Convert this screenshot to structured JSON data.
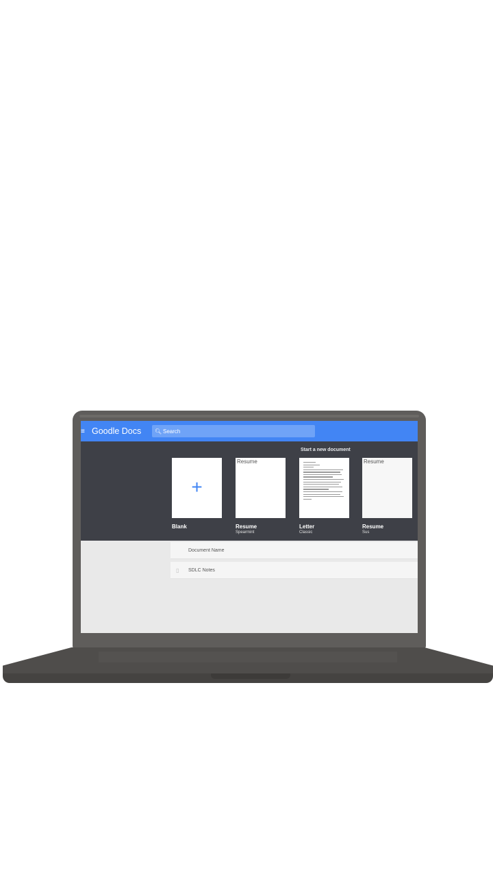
{
  "app": {
    "title": "Goodle Docs",
    "menu_icon": "≡",
    "search": {
      "icon": "search-icon",
      "placeholder": "Search"
    }
  },
  "templates": {
    "heading": "Start a new document",
    "items": [
      {
        "name": "Blank",
        "subtitle": "",
        "thumbnail": "plus",
        "plus": "+"
      },
      {
        "name": "Resume",
        "subtitle": "Spearmint",
        "thumbnail_alt": "Resume"
      },
      {
        "name": "Letter",
        "subtitle": "Classic",
        "thumbnail": "letter-preview"
      },
      {
        "name": "Resume",
        "subtitle": "Sus",
        "thumbnail_alt": "Resume"
      }
    ]
  },
  "documents": [
    {
      "name": "Document Name",
      "icon": "doc-icon"
    },
    {
      "name": "SDLC Notes",
      "icon": "doc-icon"
    }
  ],
  "colors": {
    "app_bar": "#4285f4",
    "template_panel": "#3e4047",
    "laptop": "#5f5d5b"
  }
}
